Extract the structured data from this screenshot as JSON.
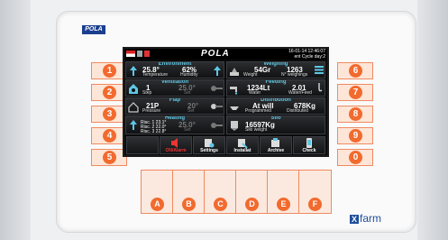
{
  "brand": "POLA",
  "screen": {
    "logo": "POLA",
    "date": "16-01-14 12:46:07",
    "cycle": "Cycle day:2",
    "cycle_prefix": "ent",
    "tiles": {
      "environment": {
        "title": "Environment",
        "temp": "25.8°",
        "temp_label": "Temperature",
        "humidity": "62%",
        "humidity_label": "Humidity"
      },
      "weighing": {
        "title": "Weighing",
        "weight": "54Gr",
        "weight_label": "Weight",
        "weighings": "1263",
        "weighings_label": "N° weighings"
      },
      "ventilation": {
        "title": "Ventilation",
        "step": "1",
        "step_label": "Step",
        "set": "25.0°",
        "set_label": "Set"
      },
      "feeding": {
        "title": "Feeding",
        "water": "1234Lt",
        "water_label": "Water",
        "ratio": "2.01",
        "ratio_label": "Water/Feed"
      },
      "flap": {
        "title": "Flap",
        "pressure": "21P",
        "pressure_label": "Pressure",
        "set": "20°",
        "set_label": "Set"
      },
      "distribution": {
        "title": "Distribution",
        "programmed": "At will",
        "programmed_label": "Programmed",
        "distributed": "678Kg",
        "distributed_label": "Distributed"
      },
      "heating": {
        "title": "Heating",
        "r1": "Risc. 1  23.1°",
        "r2": "Risc. 2  22.0°",
        "r3": "Risc. 3  22.8°",
        "set": "25.0°",
        "set_label": "Set"
      },
      "silo": {
        "title": "Silo",
        "weight": "16597Kg",
        "weight_label": "Silo weight"
      }
    },
    "buttons": [
      {
        "label": ""
      },
      {
        "label": "ON/Alarm"
      },
      {
        "label": "Settings"
      },
      {
        "label": "Installat"
      },
      {
        "label": "Archive"
      },
      {
        "label": "Check"
      }
    ]
  },
  "left_keys": [
    "1",
    "2",
    "3",
    "4",
    "5"
  ],
  "right_keys": [
    "6",
    "7",
    "8",
    "9",
    "0"
  ],
  "function_keys": [
    "A",
    "B",
    "C",
    "D",
    "E",
    "F"
  ],
  "footer_brand": "farm",
  "footer_brand_mark": "X",
  "colors": {
    "key": "#f26a2e",
    "title": "#5ec7e4",
    "brand": "#1a3f8f"
  }
}
